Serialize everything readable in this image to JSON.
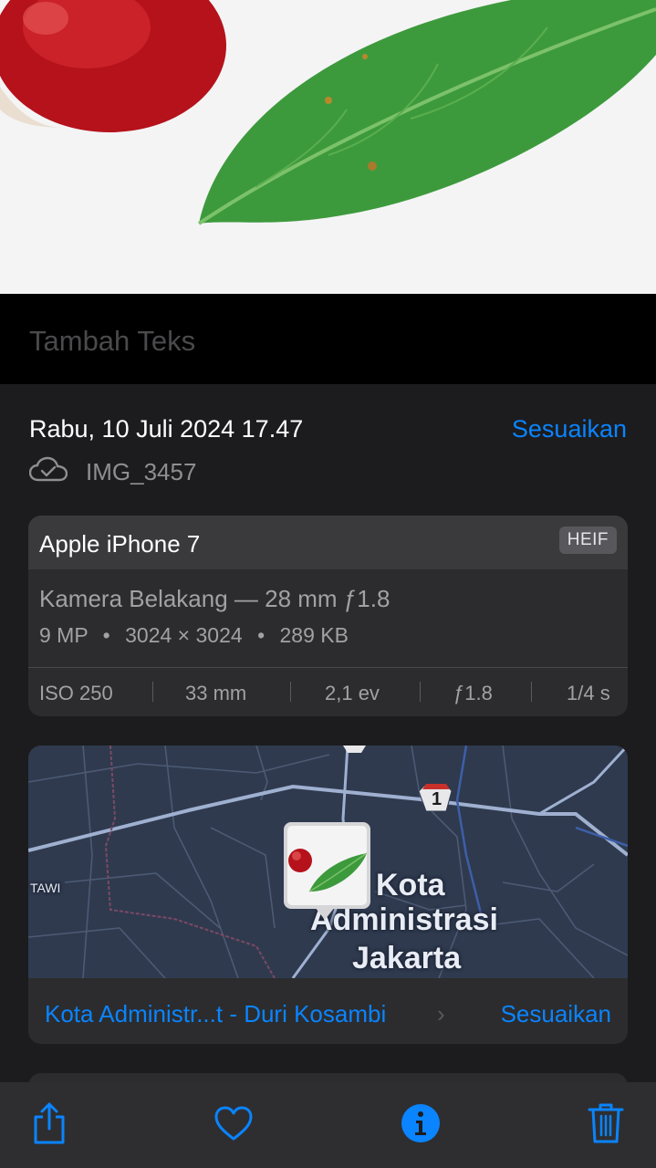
{
  "caption": {
    "placeholder": "Tambah Teks"
  },
  "info": {
    "datetime": "Rabu, 10 Juli 2024 17.47",
    "adjust_label": "Sesuaikan",
    "filename": "IMG_3457",
    "cloud_icon": "icloud-check-icon"
  },
  "device": {
    "name": "Apple iPhone 7",
    "format_badge": "HEIF",
    "lens": "Kamera Belakang — 28 mm ƒ1.8",
    "megapixels": "9 MP",
    "resolution": "3024 × 3024",
    "file_size": "289 KB",
    "spec_separator": "•",
    "exif": {
      "iso": "ISO 250",
      "focal_length": "33 mm",
      "exposure_bias": "2,1 ev",
      "aperture": "ƒ1.8",
      "shutter": "1/4 s"
    }
  },
  "map": {
    "city_line1": "Kota",
    "city_line2": "Administrasi",
    "city_line3": "Jakarta",
    "road_badge": "1",
    "area_label": "TAWI",
    "location_text": "Kota Administr...t - Duri Kosambi",
    "location_chevron": "›",
    "adjust_label": "Sesuaikan"
  },
  "toolbar": {
    "items": [
      "share-icon",
      "heart-icon",
      "info-icon",
      "trash-icon"
    ]
  },
  "colors": {
    "accent": "#0a84ff",
    "panel": "#1c1c1e",
    "card": "#2c2c2e"
  }
}
